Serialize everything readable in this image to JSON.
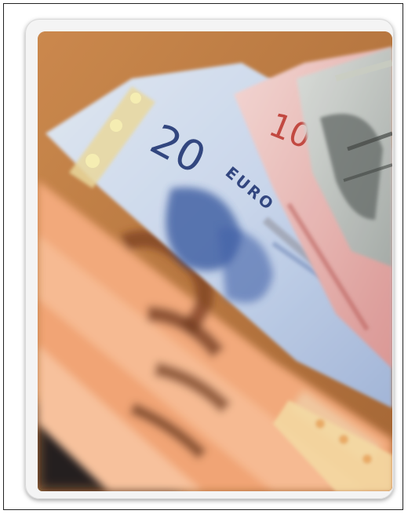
{
  "photo": {
    "subject": "",
    "visible_denomination": "20",
    "visible_currency": "EURO",
    "partial_denomination": "10",
    "colors": {
      "wood": "#b8703a",
      "note_20_blue": "#7f9cc8",
      "note_10_red": "#d98d8a",
      "note_50_orange": "#f2a878",
      "note_grey": "#9aa0a0"
    }
  }
}
